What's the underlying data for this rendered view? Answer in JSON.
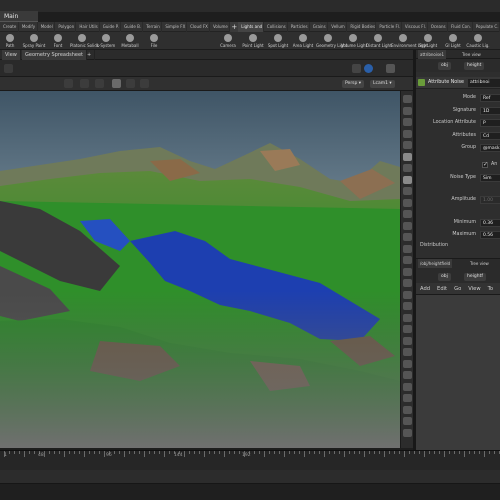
{
  "window": {
    "desktop_label": "Main"
  },
  "shelf_tabs": [
    {
      "label": "Create",
      "active": false
    },
    {
      "label": "Modify",
      "active": false
    },
    {
      "label": "Model",
      "active": false
    },
    {
      "label": "Polygon",
      "active": false
    },
    {
      "label": "Hair Utils",
      "active": false
    },
    {
      "label": "Guide P.",
      "active": false
    },
    {
      "label": "Guide B.",
      "active": false
    },
    {
      "label": "Terrain",
      "active": false
    },
    {
      "label": "Simple FX",
      "active": false
    },
    {
      "label": "Cloud FX",
      "active": false
    },
    {
      "label": "Volume",
      "active": false
    },
    {
      "label": "Lights and",
      "active": true
    },
    {
      "label": "Collisions",
      "active": false
    },
    {
      "label": "Particles",
      "active": false
    },
    {
      "label": "Grains",
      "active": false
    },
    {
      "label": "Vellum",
      "active": false
    },
    {
      "label": "Rigid Bodies",
      "active": false
    },
    {
      "label": "Particle Fl.",
      "active": false
    },
    {
      "label": "Viscous Fl.",
      "active": false
    },
    {
      "label": "Oceans",
      "active": false
    },
    {
      "label": "Fluid Con.",
      "active": false
    },
    {
      "label": "Populate C.",
      "active": false
    }
  ],
  "tools_left": [
    {
      "label": "Path",
      "icon": "path-icon"
    },
    {
      "label": "Spray Paint",
      "icon": "spray-paint-icon"
    },
    {
      "label": "Font",
      "icon": "font-icon"
    },
    {
      "label": "Platonic Solids",
      "icon": "platonic-solids-icon"
    },
    {
      "label": "L-System",
      "icon": "lsystem-icon"
    },
    {
      "label": "Metaball",
      "icon": "metaball-icon"
    },
    {
      "label": "File",
      "icon": "file-icon"
    }
  ],
  "tools_right": [
    {
      "label": "Camera",
      "icon": "camera-icon"
    },
    {
      "label": "Point Light",
      "icon": "point-light-icon"
    },
    {
      "label": "Spot Light",
      "icon": "spot-light-icon"
    },
    {
      "label": "Area Light",
      "icon": "area-light-icon"
    },
    {
      "label": "Geometry Light",
      "icon": "geometry-light-icon"
    },
    {
      "label": "Volume Light",
      "icon": "volume-light-icon"
    },
    {
      "label": "Distant Light",
      "icon": "distant-light-icon"
    },
    {
      "label": "Environment Light",
      "icon": "environment-light-icon"
    },
    {
      "label": "Sky Light",
      "icon": "sky-light-icon"
    },
    {
      "label": "GI Light",
      "icon": "gi-light-icon"
    },
    {
      "label": "Caustic Lig.",
      "icon": "caustic-light-icon"
    }
  ],
  "pane_tabs": {
    "view": "View",
    "spreadsheet": "Geometry Spreadsheet",
    "add": "+"
  },
  "viewport": {
    "camera_menu": "Persp ▾",
    "cam_menu": "Lcam1 ▾"
  },
  "param_pane": {
    "tab_a": "attribnoise1",
    "tab_b": "Tree view",
    "path_obj": "obj",
    "path_node": "height",
    "node_type": "Attribute Noise",
    "node_name": "attribnoi",
    "params": [
      {
        "label": "Mode",
        "value": "Ref"
      },
      {
        "label": "Signature",
        "value": "1D"
      },
      {
        "label": "Location Attribute",
        "value": "P"
      },
      {
        "label": "Attributes",
        "value": "Cd"
      },
      {
        "label": "Group",
        "value": "@mask"
      }
    ],
    "noise": [
      {
        "label": "Noise Type",
        "value": "Sim"
      },
      {
        "label": "Amplitude",
        "value": "1.00"
      },
      {
        "label": "Minimum",
        "value": "0.36"
      },
      {
        "label": "Maximum",
        "value": "0.56"
      }
    ],
    "section_label": "Distribution",
    "checkbox_label": "An"
  },
  "network_pane": {
    "tab_a": "/obj/heightfield",
    "tab_b": "Tree view",
    "path_obj": "obj",
    "path_node": "heightf",
    "menu": [
      "Add",
      "Edit",
      "Go",
      "View",
      "To"
    ]
  },
  "timeline": {
    "frames": [
      "1",
      "48",
      "96",
      "144",
      "192"
    ]
  },
  "colors": {
    "terrain_green": "#2f8f2a",
    "water_blue": "#1d3fb0",
    "sky": "#7a8c9c"
  }
}
